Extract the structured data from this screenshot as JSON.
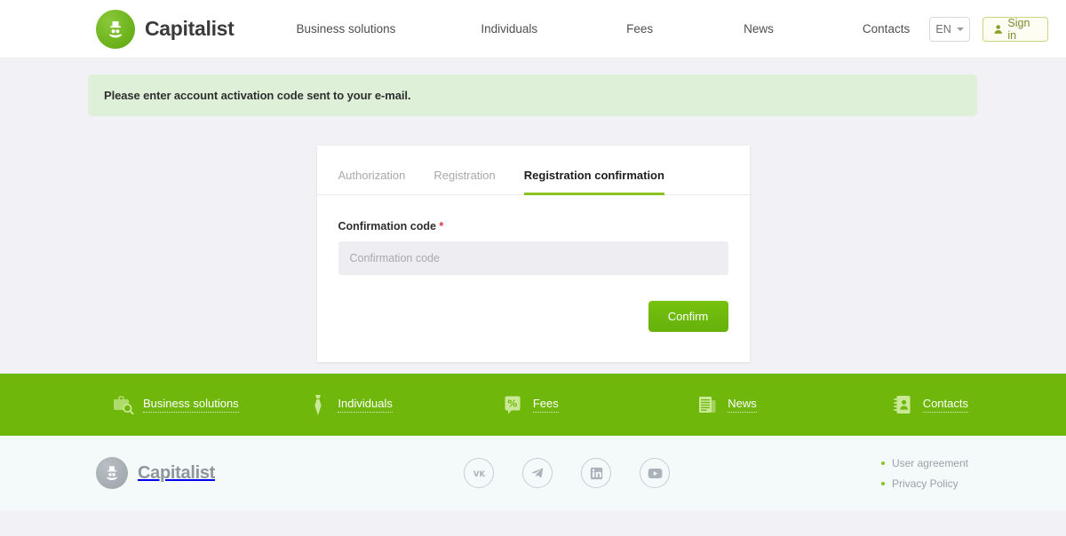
{
  "header": {
    "brand": "Capitalist",
    "logo_icon": "capitalist-gentleman-logo",
    "nav": [
      {
        "label": "Business solutions"
      },
      {
        "label": "Individuals"
      },
      {
        "label": "Fees"
      },
      {
        "label": "News"
      },
      {
        "label": "Contacts"
      }
    ],
    "language": {
      "value": "EN",
      "icon": "chevron-down-icon"
    },
    "signin": {
      "label": "Sign in",
      "icon": "user-icon",
      "border_color": "#cfd47e",
      "text_color": "#7d8a2e"
    }
  },
  "alert": {
    "message": "Please enter account activation code sent to your e-mail.",
    "background": "#dff0d8"
  },
  "card": {
    "tabs": [
      {
        "label": "Authorization",
        "active": false
      },
      {
        "label": "Registration",
        "active": false
      },
      {
        "label": "Registration confirmation",
        "active": true
      }
    ],
    "active_tab_underline_color": "#8ac422",
    "field": {
      "label": "Confirmation code",
      "required_marker": "*",
      "placeholder": "Confirmation code",
      "value": ""
    },
    "submit": {
      "label": "Confirm",
      "color": "#6fb70b"
    }
  },
  "green_nav": {
    "background": "#6fb70b",
    "items": [
      {
        "label": "Business solutions",
        "icon": "briefcase-search-icon"
      },
      {
        "label": "Individuals",
        "icon": "necktie-icon"
      },
      {
        "label": "Fees",
        "icon": "price-tag-percent-icon"
      },
      {
        "label": "News",
        "icon": "newspaper-icon"
      },
      {
        "label": "Contacts",
        "icon": "address-book-icon"
      }
    ]
  },
  "footer": {
    "brand": "Capitalist",
    "logo_icon": "capitalist-gentleman-logo-gray",
    "socials": [
      {
        "name": "vk-icon"
      },
      {
        "name": "telegram-icon"
      },
      {
        "name": "linkedin-icon"
      },
      {
        "name": "youtube-icon"
      }
    ],
    "links": [
      {
        "label": "User agreement"
      },
      {
        "label": "Privacy Policy"
      }
    ],
    "bullet_color": "#8ac422"
  }
}
